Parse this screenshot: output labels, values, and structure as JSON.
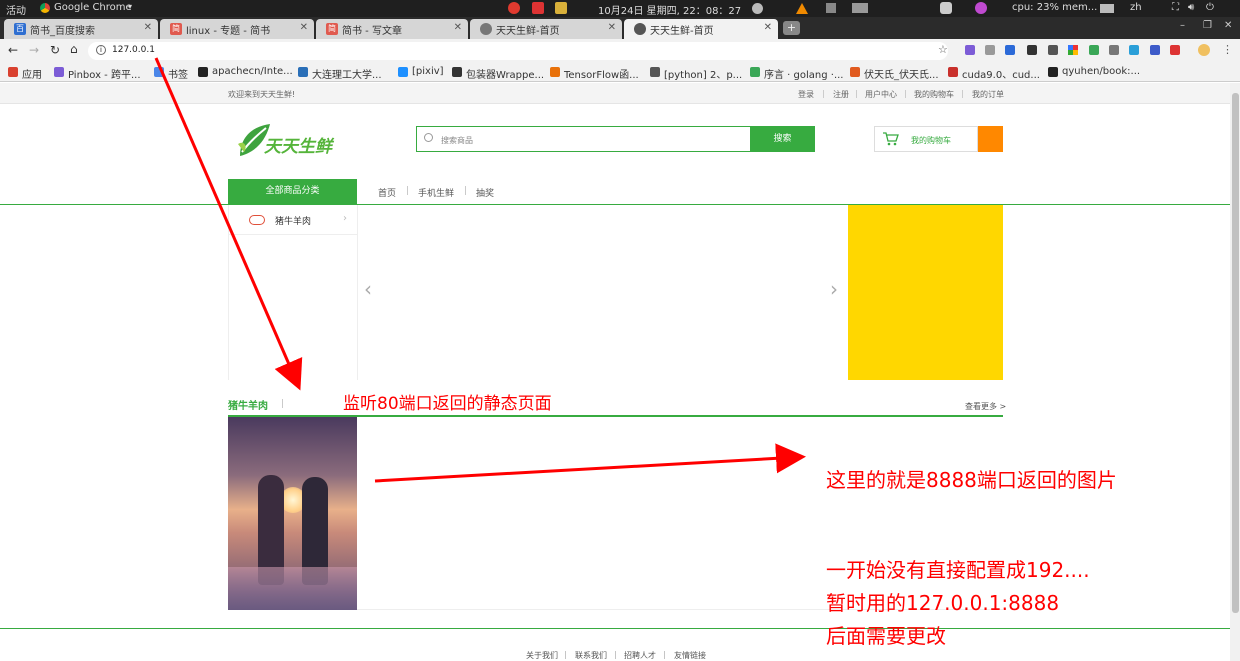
{
  "os_bar": {
    "activities": "活动",
    "app_name": "Google Chrome",
    "datetime": "10月24日 星期四, 22：08：27",
    "cpu": "cpu: 23% mem...",
    "lang": "zh"
  },
  "tabs": [
    {
      "label": "简书_百度搜索",
      "active": false
    },
    {
      "label": "linux - 专题 - 简书",
      "active": false
    },
    {
      "label": "简书 - 写文章",
      "active": false
    },
    {
      "label": "天天生鲜-首页",
      "active": false
    },
    {
      "label": "天天生鲜-首页",
      "active": true
    }
  ],
  "address_bar": {
    "url": "127.0.0.1"
  },
  "bookmarks": [
    {
      "label": "应用",
      "icon": "apps-grid-icon",
      "color": "#d9412f"
    },
    {
      "label": "Pinbox - 跨平...",
      "icon": "pinbox-icon",
      "color": "#7c5cd6"
    },
    {
      "label": "书签",
      "icon": "folder-icon",
      "color": "#4a86e8"
    },
    {
      "label": "apachecn/Inte...",
      "icon": "github-icon",
      "color": "#222222"
    },
    {
      "label": "大连理工大学...",
      "icon": "university-icon",
      "color": "#2a6fb8"
    },
    {
      "label": "[pixiv]",
      "icon": "pixiv-icon",
      "color": "#1e90ff"
    },
    {
      "label": "包装器Wrappe...",
      "icon": "book-icon",
      "color": "#333333"
    },
    {
      "label": "TensorFlow函...",
      "icon": "tensorflow-icon",
      "color": "#e8710a"
    },
    {
      "label": "[python] 2、p...",
      "icon": "python-icon",
      "color": "#555555"
    },
    {
      "label": "序言 · golang ·...",
      "icon": "gitbook-icon",
      "color": "#3aa757"
    },
    {
      "label": "伏天氏_伏天氏...",
      "icon": "novel-icon",
      "color": "#e05a1f"
    },
    {
      "label": "cuda9.0、cud...",
      "icon": "csdn-icon",
      "color": "#c9302c"
    },
    {
      "label": "qyuhen/book:...",
      "icon": "github-icon",
      "color": "#222222"
    }
  ],
  "site": {
    "welcome": "欢迎来到天天生鲜!",
    "user_links": [
      "登录",
      "注册",
      "用户中心",
      "我的购物车",
      "我的订单"
    ],
    "logo_text": "天天生鲜",
    "search_placeholder": "搜索商品",
    "search_button": "搜索",
    "cart_label": "我的购物车",
    "all_categories": "全部商品分类",
    "nav": [
      "首页",
      "手机生鲜",
      "抽奖"
    ],
    "category_item": "猪牛羊肉",
    "section_title": "猪牛羊肉",
    "section_more": "查看更多 >",
    "footer_links": [
      "关于我们",
      "联系我们",
      "招聘人才",
      "友情链接"
    ]
  },
  "annotations": {
    "top": "监听80端口返回的静态页面",
    "right_1": "这里的就是8888端口返回的图片",
    "right_2": "一开始没有直接配置成192....",
    "right_3": "暂时用的127.0.0.1:8888",
    "right_4": "后面需要更改"
  },
  "colors": {
    "brand_green": "#37ab40",
    "banner_yellow": "#ffd700",
    "cart_orange": "#ff8800",
    "annotation_red": "#ff0000"
  }
}
